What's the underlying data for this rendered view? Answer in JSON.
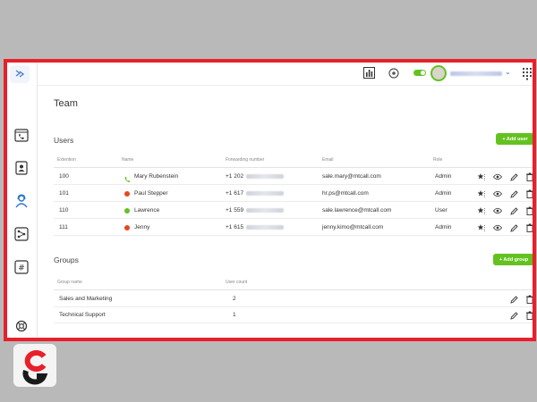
{
  "header": {
    "user_name": ""
  },
  "page": {
    "title": "Team"
  },
  "users": {
    "section_title": "Users",
    "add_button": "+ Add user",
    "columns": [
      "Extention",
      "Name",
      "Forwarding number",
      "Email",
      "Role"
    ],
    "rows": [
      {
        "extension": "100",
        "name": "Mary Rubenstein",
        "forwarding": "+1 202",
        "email": "sale.mary@mtcall.com",
        "role": "Admin",
        "status": "phone-green"
      },
      {
        "extension": "101",
        "name": "Paul Stepper",
        "forwarding": "+1 617",
        "email": "hr.ps@mtcall.com",
        "role": "Admin",
        "status": "red"
      },
      {
        "extension": "110",
        "name": "Lawrence",
        "forwarding": "+1 559",
        "email": "sale.lawrence@mtcall.com",
        "role": "User",
        "status": "green"
      },
      {
        "extension": "111",
        "name": "Jenny",
        "forwarding": "+1 615",
        "email": "jenny.kimo@mtcall.com",
        "role": "Admin",
        "status": "red"
      }
    ]
  },
  "groups": {
    "section_title": "Groups",
    "add_button": "+ Add group",
    "columns": [
      "Group name",
      "User count"
    ],
    "rows": [
      {
        "name": "Sales and Marketing",
        "count": "2"
      },
      {
        "name": "Technical Support",
        "count": "1"
      }
    ]
  },
  "colors": {
    "accent_green": "#63c21f",
    "status_red": "#e24a1f",
    "frame_red": "#e8202a"
  }
}
